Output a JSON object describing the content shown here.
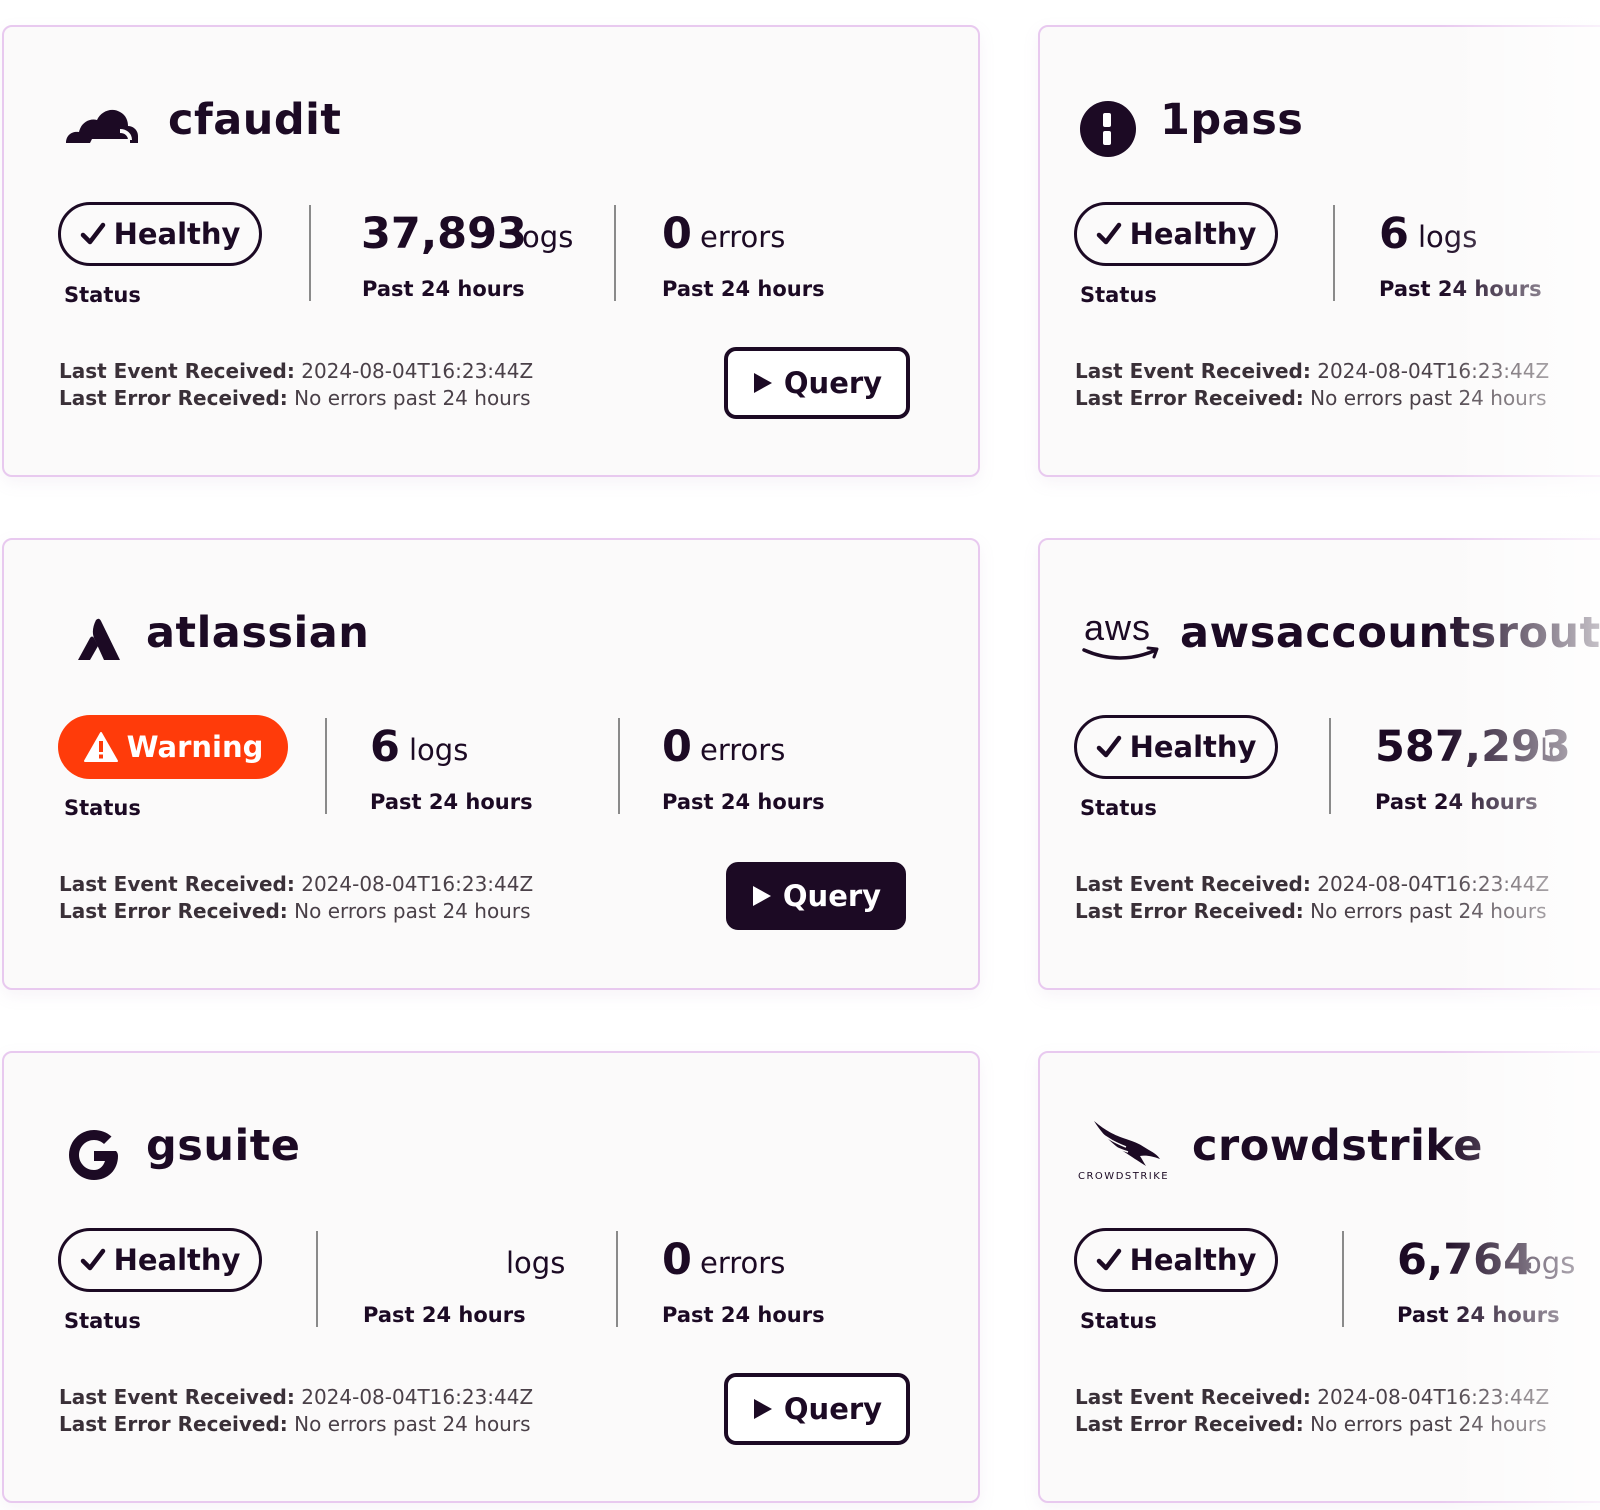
{
  "common": {
    "status_label": "Status",
    "period_label": "Past 24 hours",
    "logs_unit": "logs",
    "errors_unit": "errors",
    "last_event_label": "Last Event Received:",
    "last_error_label": "Last Error Received:",
    "query_label": "Query",
    "healthy_label": "Healthy",
    "warning_label": "Warning"
  },
  "colors": {
    "ink": "#1c0a24",
    "warning": "#ff3b0a",
    "card_border": "#e8c9ef",
    "card_bg": "#fbfafa"
  },
  "cards": [
    {
      "name": "cfaudit",
      "icon": "cloudflare-icon",
      "status": "Healthy",
      "logs": "37,893",
      "errors": "0",
      "last_event": "2024-08-04T16:23:44Z",
      "last_error": "No errors past 24 hours"
    },
    {
      "name": "1pass",
      "icon": "onepassword-icon",
      "status": "Healthy",
      "logs": "6",
      "last_event": "2024-08-04T16:23:44Z",
      "last_error": "No errors past 24 hours"
    },
    {
      "name": "atlassian",
      "icon": "atlassian-icon",
      "status": "Warning",
      "logs": "6",
      "errors": "0",
      "last_event": "2024-08-04T16:23:44Z",
      "last_error": "No errors past 24 hours"
    },
    {
      "name": "awsaccountsrouti",
      "icon": "aws-icon",
      "logo_text": "aws",
      "status": "Healthy",
      "logs": "587,293",
      "logs_unit": "lo",
      "last_event": "2024-08-04T16:23:44Z",
      "last_error": "No errors past 24 hours"
    },
    {
      "name": "gsuite",
      "icon": "google-icon",
      "status": "Healthy",
      "logs": "",
      "errors": "0",
      "last_event": "2024-08-04T16:23:44Z",
      "last_error": "No errors past 24 hours"
    },
    {
      "name": "crowdstrike",
      "icon": "crowdstrike-icon",
      "logo_text": "CROWDSTRIKE",
      "status": "Healthy",
      "logs": "6,764",
      "logs_unit": "logs",
      "last_event": "2024-08-04T16:23:44Z",
      "last_error": "No errors past 24 hours"
    }
  ]
}
